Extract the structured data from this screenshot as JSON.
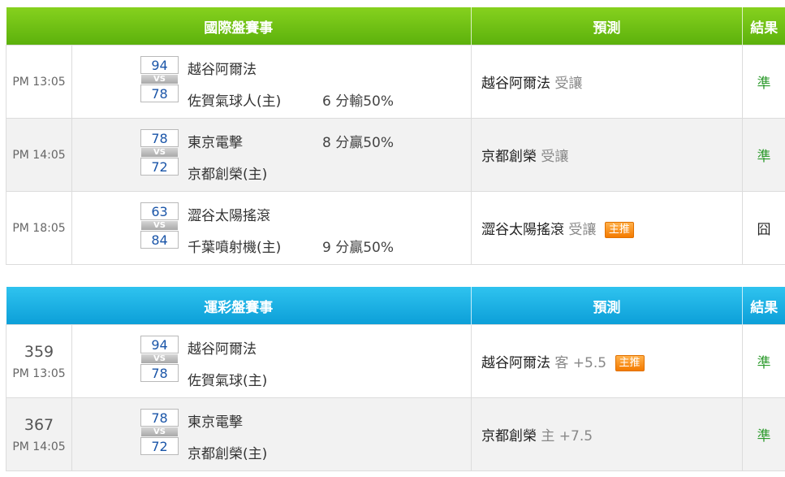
{
  "international": {
    "header": {
      "match_col": "國際盤賽事",
      "pred_col": "預測",
      "result_col": "結果"
    },
    "rows": [
      {
        "time": "PM 13:05",
        "top_score": "94",
        "top_team": "越谷阿爾法",
        "bottom_score": "78",
        "bottom_team": "佐賀氣球人(主)",
        "line": "6 分輸50%",
        "line_pos": "bottom",
        "pred_team": "越谷阿爾法",
        "pred_sub": "受讓",
        "tag": "",
        "result": "準"
      },
      {
        "time": "PM 14:05",
        "top_score": "78",
        "top_team": "東京電擊",
        "bottom_score": "72",
        "bottom_team": "京都創榮(主)",
        "line": "8 分贏50%",
        "line_pos": "top",
        "pred_team": "京都創榮",
        "pred_sub": "受讓",
        "tag": "",
        "result": "準"
      },
      {
        "time": "PM 18:05",
        "top_score": "63",
        "top_team": "澀谷太陽搖滾",
        "bottom_score": "84",
        "bottom_team": "千葉噴射機(主)",
        "line": "9 分贏50%",
        "line_pos": "bottom",
        "pred_team": "澀谷太陽搖滾",
        "pred_sub": "受讓",
        "tag": "主推",
        "result": "囧"
      }
    ]
  },
  "sports_lottery": {
    "header": {
      "match_col": "運彩盤賽事",
      "pred_col": "預測",
      "result_col": "結果"
    },
    "rows": [
      {
        "num": "359",
        "time": "PM 13:05",
        "top_score": "94",
        "top_team": "越谷阿爾法",
        "bottom_score": "78",
        "bottom_team": "佐賀氣球(主)",
        "pred_team": "越谷阿爾法",
        "pred_sub": "客 +5.5",
        "tag": "主推",
        "result": "準"
      },
      {
        "num": "367",
        "time": "PM 14:05",
        "top_score": "78",
        "top_team": "東京電擊",
        "bottom_score": "72",
        "bottom_team": "京都創榮(主)",
        "pred_team": "京都創榮",
        "pred_sub": "主 +7.5",
        "tag": "",
        "result": "準"
      }
    ]
  },
  "vs_label": "VS",
  "colors": {
    "green_header": "#6cbf14",
    "blue_header": "#1cb0e6",
    "win_text": "#2e9b2e",
    "score_text": "#1a55a8",
    "tag_orange": "#f47b00"
  }
}
